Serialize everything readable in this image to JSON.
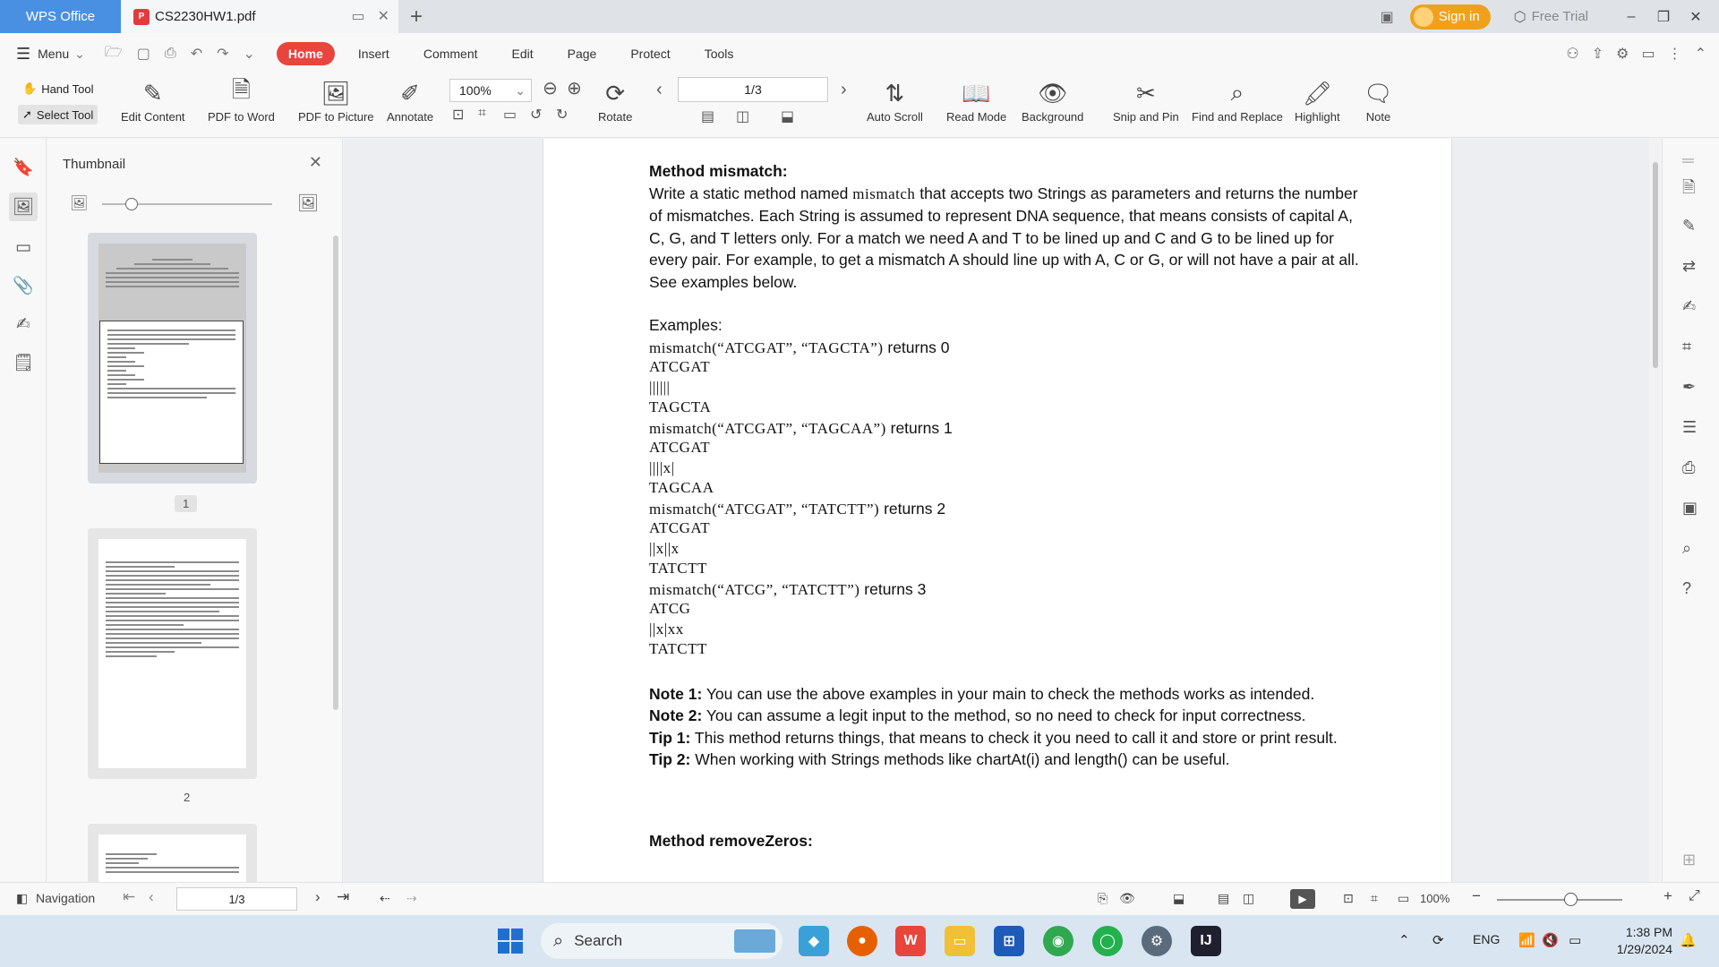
{
  "titlebar": {
    "app_tab": "WPS Office",
    "doc_tab": "CS2230HW1.pdf",
    "sign_in": "Sign in",
    "free_trial": "Free Trial"
  },
  "menu": {
    "menu_label": "Menu",
    "tabs": [
      "Home",
      "Insert",
      "Comment",
      "Edit",
      "Page",
      "Protect",
      "Tools"
    ]
  },
  "ribbon": {
    "hand_tool": "Hand Tool",
    "select_tool": "Select Tool",
    "edit_content": "Edit Content",
    "pdf_to_word": "PDF to Word",
    "pdf_to_picture": "PDF to Picture",
    "annotate": "Annotate",
    "zoom": "100%",
    "rotate": "Rotate",
    "page_indicator": "1/3",
    "auto_scroll": "Auto Scroll",
    "read_mode": "Read Mode",
    "background": "Background",
    "snip_and_pin": "Snip and Pin",
    "find_and_replace": "Find and Replace",
    "highlight": "Highlight",
    "note": "Note"
  },
  "thumbnail": {
    "title": "Thumbnail",
    "page1_num": "1",
    "page2_num": "2"
  },
  "document": {
    "heading1": "Method mismatch:",
    "para_prefix": "Write a static method named ",
    "para_code": "mismatch",
    "para_rest": " that accepts two Strings as parameters and returns the number of mismatches. Each String is assumed to represent DNA sequence, that means consists of capital A, C, G, and T letters only. For a match we need A and T to be lined up and C and G to be lined up for every pair. For example, to get a mismatch A should line up with A, C or G, or will not have a pair at all. See examples below.",
    "examples_label": "Examples:",
    "examples": [
      {
        "call": "mismatch(“ATCGAT”, “TAGCTA”)",
        "returns_word": "returns",
        "result": "0",
        "line1": "ATCGAT",
        "line2": "||||||",
        "line3": "TAGCTA"
      },
      {
        "call": "mismatch(“ATCGAT”, “TAGCAA”)",
        "returns_word": "returns",
        "result": "1",
        "line1": "ATCGAT",
        "line2": "||||x|",
        "line3": "TAGCAA"
      },
      {
        "call": "mismatch(“ATCGAT”, “TATCTT”)",
        "returns_word": "returns",
        "result": "2",
        "line1": "ATCGAT",
        "line2": "||x||x",
        "line3": "TATCTT"
      },
      {
        "call": "mismatch(“ATCG”, “TATCTT”)",
        "returns_word": "returns",
        "result": "3",
        "line1": "ATCG",
        "line2": "||x|xx",
        "line3": "TATCTT"
      }
    ],
    "note1_label": "Note 1:",
    "note1_text": " You can use the above examples in your main to check the methods works as intended.",
    "note2_label": "Note 2:",
    "note2_text": " You can assume a legit input to the method, so no need to check for input correctness.",
    "tip1_label": "Tip 1:",
    "tip1_text": " This method returns things, that means to check it you need to call it and store or print result.",
    "tip2_label": "Tip 2:",
    "tip2_text": " When working with Strings methods like chartAt(i) and length() can be useful.",
    "heading2": "Method removeZeros:"
  },
  "statusbar": {
    "navigation": "Navigation",
    "page": "1/3",
    "zoom": "100%"
  },
  "taskbar": {
    "search": "Search",
    "lang": "ENG",
    "time": "1:38 PM",
    "date": "1/29/2024"
  },
  "colors": {
    "accent_red": "#e8453c",
    "wps_blue": "#4a90e2",
    "signin_orange": "#f0a11b"
  }
}
